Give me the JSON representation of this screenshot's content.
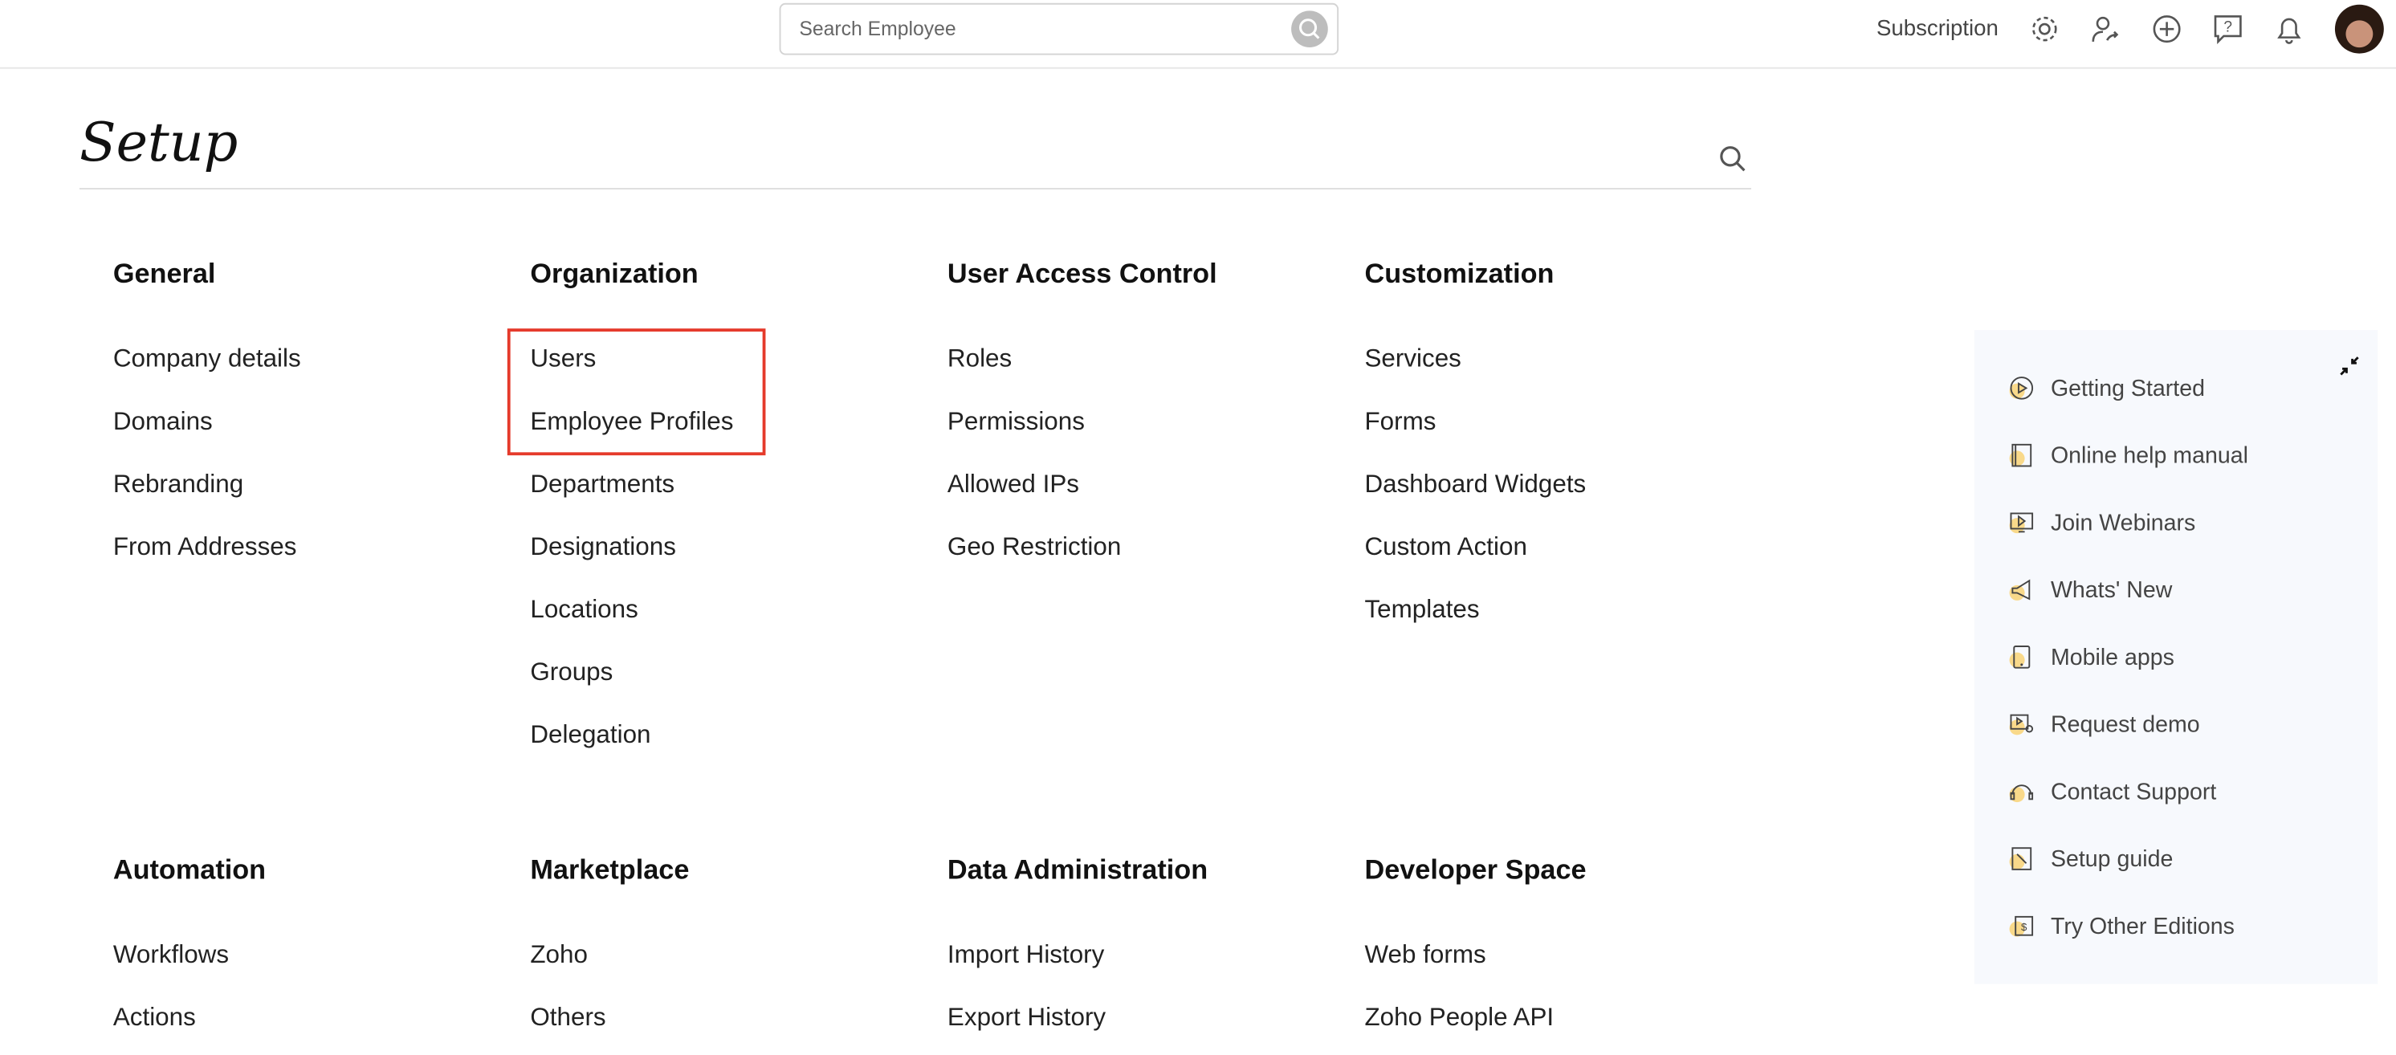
{
  "topbar": {
    "search_placeholder": "Search Employee",
    "subscription": "Subscription",
    "icons": [
      "settings-icon",
      "user-switch-icon",
      "add-icon",
      "help-icon",
      "bell-icon"
    ]
  },
  "page": {
    "title": "Setup"
  },
  "sections": [
    {
      "title": "General",
      "items": [
        "Company details",
        "Domains",
        "Rebranding",
        "From Addresses"
      ]
    },
    {
      "title": "Organization",
      "items": [
        "Users",
        "Employee Profiles",
        "Departments",
        "Designations",
        "Locations",
        "Groups",
        "Delegation"
      ]
    },
    {
      "title": "User Access Control",
      "items": [
        "Roles",
        "Permissions",
        "Allowed IPs",
        "Geo Restriction"
      ]
    },
    {
      "title": "Customization",
      "items": [
        "Services",
        "Forms",
        "Dashboard Widgets",
        "Custom Action",
        "Templates"
      ]
    },
    {
      "title": "Automation",
      "items": [
        "Workflows",
        "Actions"
      ]
    },
    {
      "title": "Marketplace",
      "items": [
        "Zoho",
        "Others"
      ]
    },
    {
      "title": "Data Administration",
      "items": [
        "Import History",
        "Export History"
      ]
    },
    {
      "title": "Developer Space",
      "items": [
        "Web forms",
        "Zoho People API"
      ]
    }
  ],
  "help_panel": {
    "items": [
      "Getting Started",
      "Online help manual",
      "Join Webinars",
      "Whats' New",
      "Mobile apps",
      "Request demo",
      "Contact Support",
      "Setup guide",
      "Try Other Editions"
    ]
  },
  "colors": {
    "highlight": "#e53a2b",
    "panel_bg": "#f7f9fd",
    "icon_accent": "#f9d98a"
  }
}
